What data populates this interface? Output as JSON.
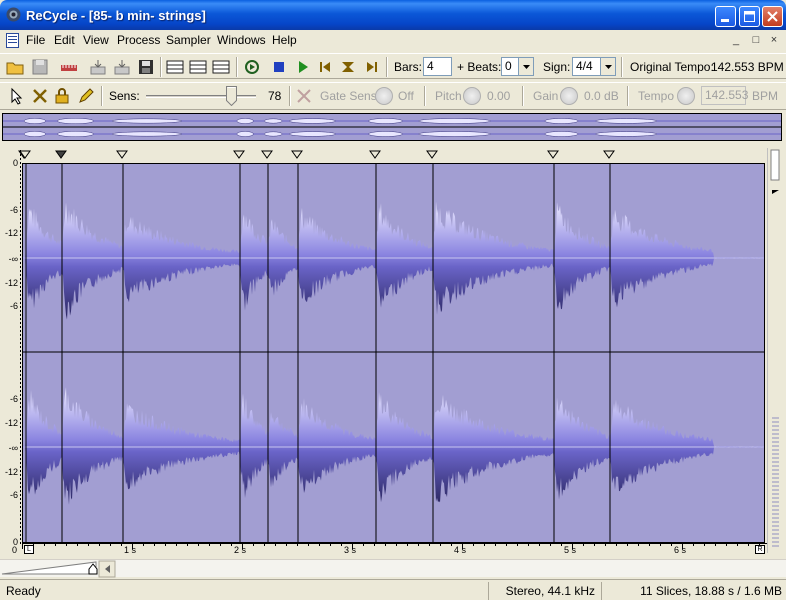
{
  "window": {
    "title": "ReCycle - [85- b min- strings]",
    "app_icon": "recycle-app-icon",
    "controls": [
      "minimize",
      "maximize",
      "close"
    ]
  },
  "menu": {
    "items": [
      "File",
      "Edit",
      "View",
      "Process",
      "Sampler",
      "Windows",
      "Help"
    ],
    "mdi_controls": [
      "_",
      "□",
      "×"
    ]
  },
  "toolbar1": {
    "icons": [
      "open-folder-icon",
      "save-icon",
      "ruler-icon",
      "export-icon",
      "export-alt-icon",
      "disk-icon",
      "list-view-icon",
      "list-view2-icon",
      "list-view3-icon",
      "loop-play-icon",
      "stop-icon",
      "play-icon",
      "skip-back-icon",
      "eject-icon",
      "skip-forward-icon"
    ],
    "bars_label": "Bars:",
    "bars_value": "4",
    "beats_label": "+ Beats:",
    "beats_value": "0",
    "sign_label": "Sign:",
    "sign_value": "4/4",
    "tempo_label": "Original Tempo:",
    "tempo_value": "142.553 BPM"
  },
  "toolbar2": {
    "icons": [
      "pointer-icon",
      "scissors-icon",
      "lock-icon",
      "pencil-icon"
    ],
    "sens_label": "Sens:",
    "sens_value": "78",
    "sens_level_percent": 78,
    "gate_sens_label": "Gate Sens",
    "gate_sens_value": "Off",
    "pitch_label": "Pitch",
    "pitch_value": "0.00",
    "gain_label": "Gain",
    "gain_value": "0.0 dB",
    "tempo_label": "Tempo",
    "tempo_value": "142.553",
    "tempo_unit": "BPM"
  },
  "editor": {
    "db_labels_top": [
      "0",
      "-6",
      "-12",
      "-∞",
      "-12",
      "-6"
    ],
    "db_labels_bottom": [
      "-6",
      "-12",
      "-∞",
      "-12",
      "-6",
      "0"
    ],
    "time_labels": [
      "0",
      "1 s",
      "2 s",
      "3 s",
      "4 s",
      "5 s",
      "6 s"
    ],
    "left_locator": "L",
    "right_locator": "R",
    "slice_count": 11
  },
  "status": {
    "ready": "Ready",
    "format": "Stereo, 44.1 kHz",
    "info": "11 Slices, 18.88 s / 1.6 MB"
  },
  "colors": {
    "wave_bg": "#a29ed2",
    "wave_fill": "#4a4696",
    "wave_light": "#e8e6ff",
    "title_blue": "#0b58d8"
  }
}
